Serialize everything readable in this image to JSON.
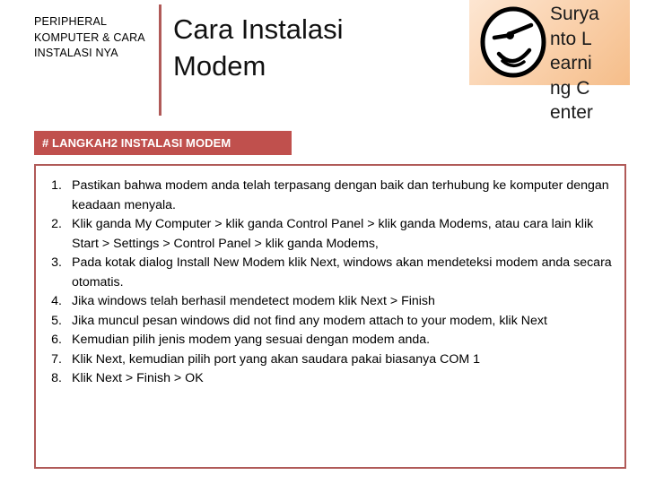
{
  "header": {
    "kicker": "PERIPHERAL KOMPUTER & CARA INSTALASI NYA",
    "title": "Cara Instalasi Modem"
  },
  "logo": {
    "icon": "winking-smiley-face-icon",
    "text": "Suryanto Learning Center",
    "box_gradient_from": "#FDE6D2",
    "box_gradient_to": "#F5BD89"
  },
  "section": {
    "banner_label": "# LANGKAH2 INSTALASI MODEM",
    "banner_color": "#C0504D",
    "border_color": "#B05A58"
  },
  "steps": [
    {
      "number": "1.",
      "text": "Pastikan bahwa modem anda telah terpasang dengan baik dan terhubung ke komputer dengan keadaan menyala."
    },
    {
      "number": "2.",
      "text": "Klik ganda My Computer > klik ganda Control Panel > klik ganda Modems, atau cara lain klik Start > Settings > Control Panel > klik ganda Modems,"
    },
    {
      "number": "3.",
      "text": "Pada kotak dialog Install New Modem klik Next, windows akan mendeteksi modem anda secara otomatis."
    },
    {
      "number": "4.",
      "text": "Jika windows telah berhasil mendetect modem klik Next > Finish"
    },
    {
      "number": "5.",
      "text": "Jika muncul pesan windows did not find any modem attach to your modem, klik Next"
    },
    {
      "number": "6.",
      "text": "Kemudian pilih jenis modem yang sesuai dengan modem anda."
    },
    {
      "number": "7.",
      "text": "Klik Next, kemudian pilih port yang akan saudara pakai biasanya COM 1"
    },
    {
      "number": "8.",
      "text": "Klik Next > Finish > OK"
    }
  ]
}
